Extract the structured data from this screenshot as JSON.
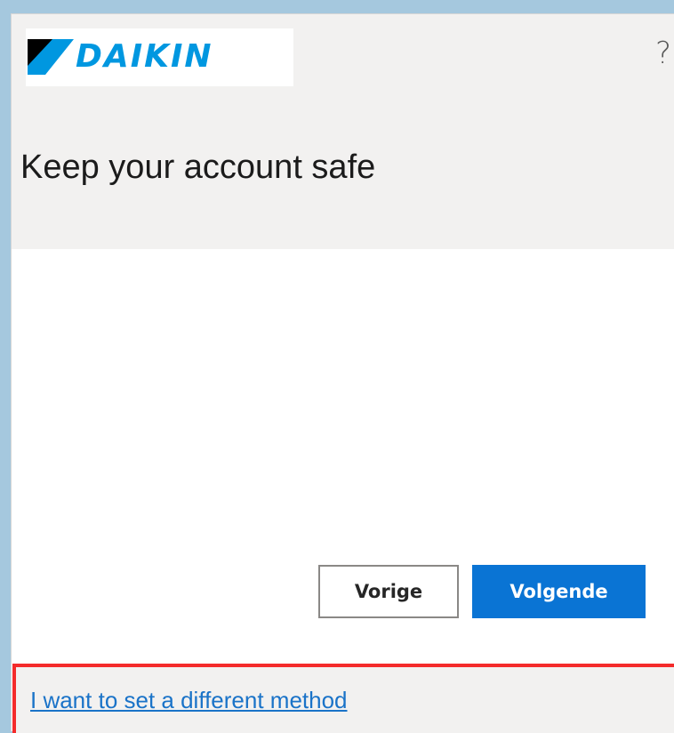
{
  "brand": {
    "logo_text": "DAIKIN",
    "logo_color": "#0097e0",
    "logo_mark_color": "#000000"
  },
  "header": {
    "help_label": "?",
    "title": "Keep your account safe"
  },
  "actions": {
    "previous_label": "Vorige",
    "next_label": "Volgende",
    "next_color": "#0a74d4"
  },
  "footer": {
    "link_label": "I want to set a different method",
    "highlight_color": "#f42b2b"
  }
}
